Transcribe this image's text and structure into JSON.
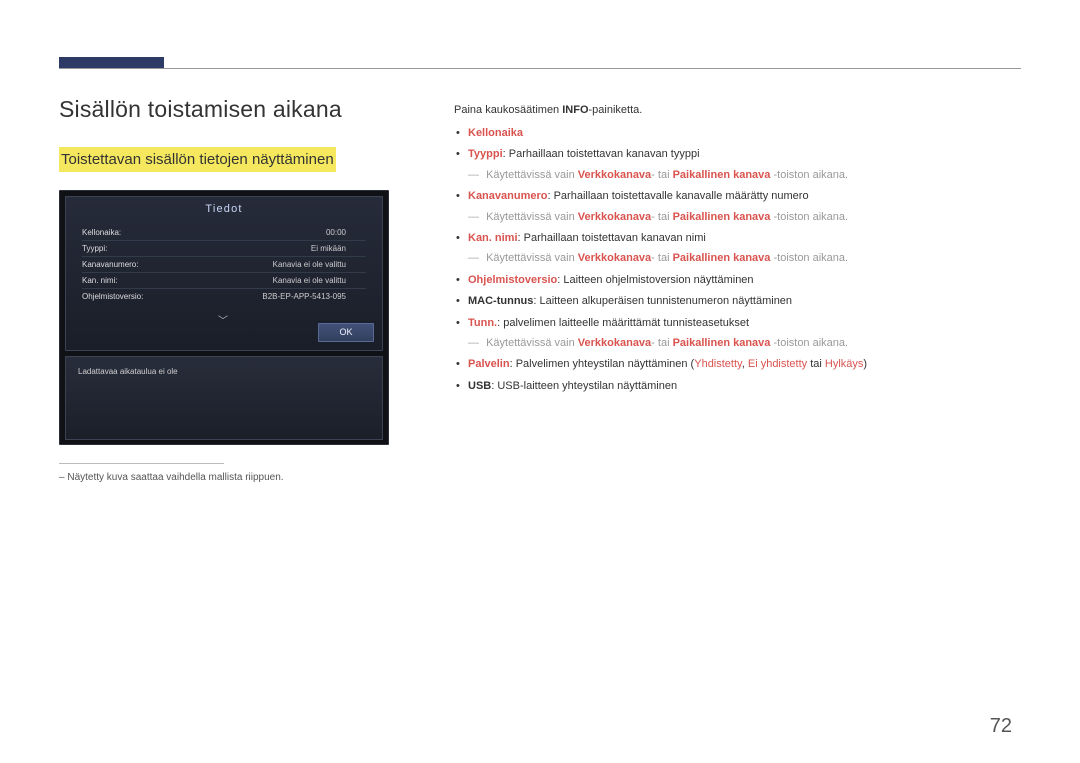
{
  "header": {
    "h1": "Sisällön toistamisen aikana",
    "h2": "Toistettavan sisällön tietojen näyttäminen"
  },
  "device": {
    "panel_title": "Tiedot",
    "rows": [
      {
        "k": "Kellonaika:",
        "v": "00:00"
      },
      {
        "k": "Tyyppi:",
        "v": "Ei mikään"
      },
      {
        "k": "Kanavanumero:",
        "v": "Kanavia ei ole valittu"
      },
      {
        "k": "Kan. nimi:",
        "v": "Kanavia ei ole valittu"
      },
      {
        "k": "Ohjelmistoversio:",
        "v": "B2B-EP-APP-5413-095"
      }
    ],
    "ok": "OK",
    "schedule_empty": "Ladattavaa aikataulua ei ole"
  },
  "footnote": "Näytetty kuva saattaa vaihdella mallista riippuen.",
  "intro": {
    "pre": "Paina kaukosäätimen ",
    "bold": "INFO",
    "post": "-painiketta."
  },
  "bullets": {
    "kellonaika": "Kellonaika",
    "tyyppi_label": "Tyyppi",
    "tyyppi_text": ": Parhaillaan toistettavan kanavan tyyppi",
    "avail_pre": "Käytettävissä vain ",
    "verkk": "Verkkokanava",
    "tai": "- tai ",
    "paik": "Paikallinen kanava",
    "avail_post": " -toiston aikana.",
    "kanavanro_label": "Kanavanumero",
    "kanavanro_text": ": Parhaillaan toistettavalle kanavalle määrätty numero",
    "kannimi_label": "Kan. nimi",
    "kannimi_text": ": Parhaillaan toistettavan kanavan nimi",
    "ohj_label": "Ohjelmistoversio",
    "ohj_text": ": Laitteen ohjelmistoversion näyttäminen",
    "mac_label": "MAC-tunnus",
    "mac_text": ": Laitteen alkuperäisen tunnistenumeron näyttäminen",
    "tunn_label": "Tunn.",
    "tunn_text": ": palvelimen laitteelle määrittämät tunnisteasetukset",
    "palv_label": "Palvelin",
    "palv_text_pre": ": Palvelimen yhteystilan näyttäminen (",
    "palv_yhd": "Yhdistetty",
    "palv_sep1": ", ",
    "palv_ei": "Ei yhdistetty",
    "palv_sep2": " tai ",
    "palv_hyl": "Hylkäys",
    "palv_text_post": ")",
    "usb_label": "USB",
    "usb_text": ": USB-laitteen yhteystilan näyttäminen"
  },
  "page_number": "72"
}
